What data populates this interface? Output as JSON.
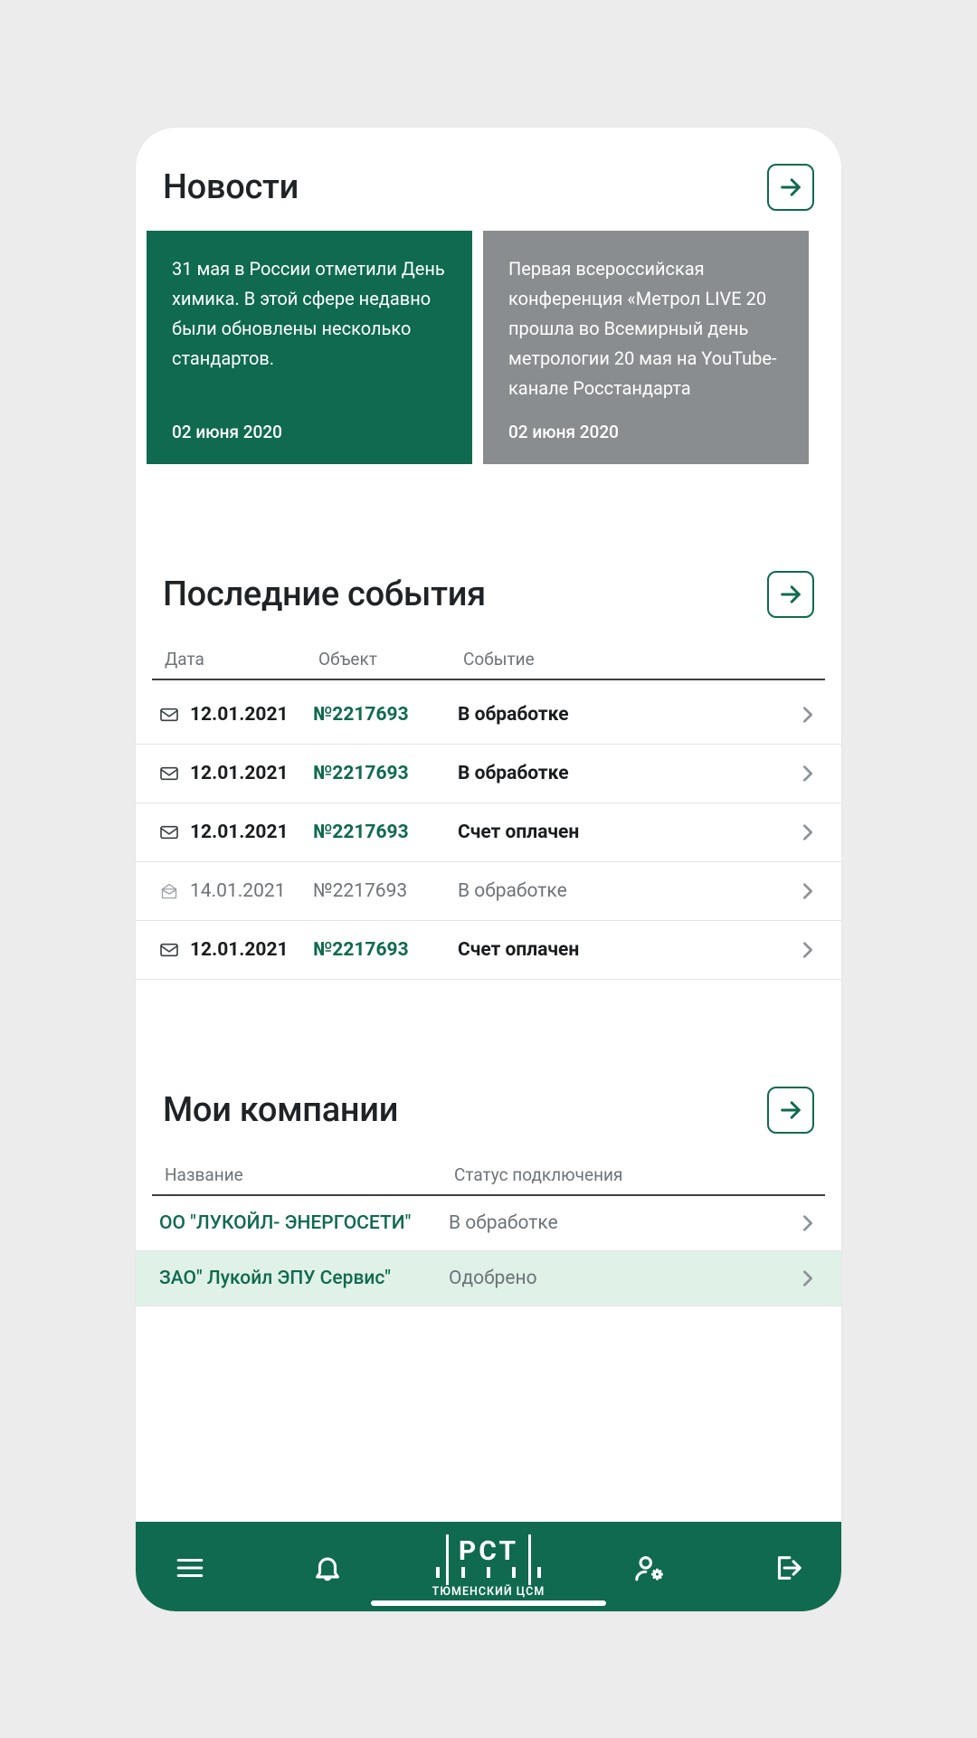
{
  "sections": {
    "news_title": "Новости",
    "events_title": "Последние события",
    "companies_title": "Мои компании"
  },
  "news": [
    {
      "text": "31 мая в России отметили День химика. В этой сфере недавно были обновлены несколько стандартов.",
      "date": "02 июня 2020"
    },
    {
      "text": "Первая всероссийская конференция «Метрол LIVE 20 прошла во Всемирный день метрологии 20 мая на YouTube-канале Росстандарта",
      "date": "02 июня 2020"
    }
  ],
  "events": {
    "headers": {
      "date": "Дата",
      "object": "Объект",
      "event": "Событие"
    },
    "rows": [
      {
        "unread": true,
        "date": "12.01.2021",
        "object": "№2217693",
        "event": "В обработке"
      },
      {
        "unread": true,
        "date": "12.01.2021",
        "object": "№2217693",
        "event": "В обработке"
      },
      {
        "unread": true,
        "date": "12.01.2021",
        "object": "№2217693",
        "event": "Счет оплачен"
      },
      {
        "unread": false,
        "date": "14.01.2021",
        "object": "№2217693",
        "event": "В обработке"
      },
      {
        "unread": true,
        "date": "12.01.2021",
        "object": "№2217693",
        "event": "Счет оплачен"
      }
    ]
  },
  "companies": {
    "headers": {
      "name": "Название",
      "status": "Статус подключения"
    },
    "rows": [
      {
        "name": "ОО \"ЛУКОЙЛ- ЭНЕРГОСЕТИ\"",
        "status": "В обработке",
        "approved": false
      },
      {
        "name": "ЗАО\" Лукойл ЭПУ Сервис\"",
        "status": "Одобрено",
        "approved": true
      }
    ]
  },
  "logo": {
    "main": "РСТ",
    "sub": "ТЮМЕНСКИЙ ЦСМ"
  },
  "colors": {
    "brand": "#0F6A4F",
    "muted": "#8A8D8F"
  }
}
